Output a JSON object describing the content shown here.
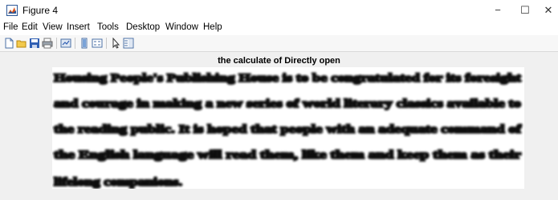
{
  "window": {
    "title": "Figure 4",
    "controls": {
      "minimize": "−",
      "maximize": "☐",
      "close": "✕"
    }
  },
  "menu": {
    "items": [
      "File",
      "Edit",
      "View",
      "Insert",
      "Tools",
      "Desktop",
      "Window",
      "Help"
    ]
  },
  "toolbar": {
    "buttons": [
      "new-figure-icon",
      "open-file-icon",
      "save-icon",
      "print-icon",
      "link-plot-icon",
      "insert-colorbar-icon",
      "insert-legend-icon",
      "pointer-icon",
      "property-inspector-icon"
    ]
  },
  "figure": {
    "title": "the calculate of Directly open",
    "image_text_lines": [
      "Housing People's Publishing House is to be congratulated for its foresight",
      "and courage in making a new series of world literary classics available to",
      "the reading public. It is hoped that people with an adequate command of",
      "the English language will read them, like them and keep them as their",
      "lifelong companions."
    ]
  }
}
